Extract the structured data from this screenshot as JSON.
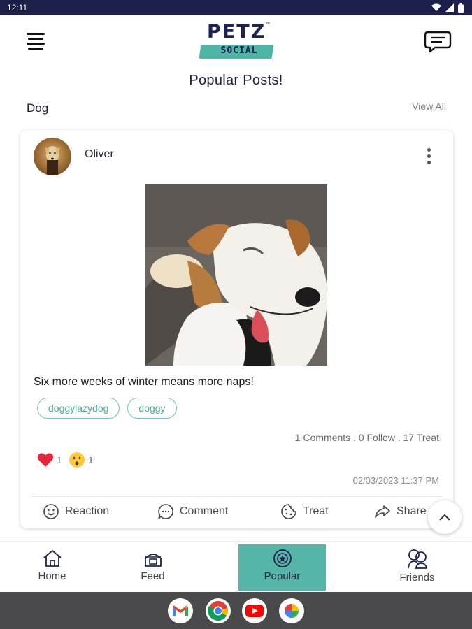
{
  "status_bar": {
    "time": "12:11"
  },
  "header": {
    "logo_main": "PETZ",
    "logo_tm": "™",
    "logo_sub": "SOCIAL"
  },
  "page_title": "Popular Posts!",
  "section": {
    "title": "Dog",
    "view_all": "View All"
  },
  "post": {
    "author": "Oliver",
    "caption": "Six more weeks of winter means more naps!",
    "tags": [
      "doggylazydog",
      "doggy"
    ],
    "stats": "1 Comments . 0 Follow . 17 Treat",
    "reactions": [
      {
        "icon": "heart-emoji",
        "count": "1"
      },
      {
        "icon": "surprised-emoji",
        "count": "1"
      }
    ],
    "timestamp": "02/03/2023 11:37 PM",
    "actions": {
      "reaction": "Reaction",
      "comment": "Comment",
      "treat": "Treat",
      "share": "Share"
    }
  },
  "bottom_nav": [
    {
      "label": "Home",
      "icon": "home-icon",
      "active": false
    },
    {
      "label": "Feed",
      "icon": "feed-icon",
      "active": false
    },
    {
      "label": "Popular",
      "icon": "popular-icon",
      "active": true
    },
    {
      "label": "Friends",
      "icon": "friends-icon",
      "active": false
    }
  ],
  "dock": [
    "gmail-icon",
    "chrome-icon",
    "youtube-icon",
    "photos-icon"
  ],
  "colors": {
    "accent": "#55b5a6",
    "navy": "#1c2350",
    "statusbar": "#1c1f4a",
    "dock": "#4a4a4c"
  }
}
